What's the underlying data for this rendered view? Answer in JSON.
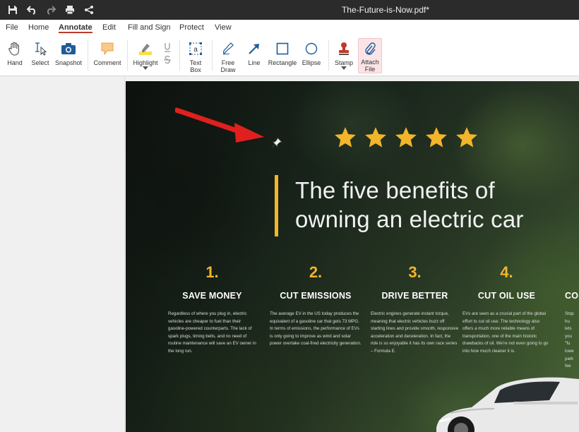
{
  "titlebar": {
    "document_title": "The-Future-is-Now.pdf*",
    "icons": [
      "save-icon",
      "undo-icon",
      "redo-icon",
      "print-icon",
      "share-icon"
    ]
  },
  "menu": {
    "items": [
      "File",
      "Home",
      "Annotate",
      "Edit",
      "Fill and Sign",
      "Protect",
      "View"
    ],
    "active": "Annotate"
  },
  "toolbar": {
    "hand": "Hand",
    "select": "Select",
    "snapshot": "Snapshot",
    "comment": "Comment",
    "highlight": "Highlight",
    "text_box": "Text\nBox",
    "free_draw": "Free\nDraw",
    "line": "Line",
    "rectangle": "Rectangle",
    "ellipse": "Ellipse",
    "stamp": "Stamp",
    "attach_file": "Attach\nFile"
  },
  "document": {
    "rating_stars": 5,
    "headline": "The five benefits of owning an electric car",
    "columns": [
      {
        "number": "1.",
        "title": "SAVE MONEY",
        "body": "Regardless of where you plug in, electric vehicles are cheaper to fuel than their gasoline-powered counterparts. The lack of spark plugs, timing belts, and no need of routine maintenance will save an EV owner in the long run."
      },
      {
        "number": "2.",
        "title": "CUT EMISSIONS",
        "body": "The average EV in the US today produces the equivalent of a gasoline car that gets 73 MPG. In terms of emissions, the performance of EVs is only going to improve as wind and solar power overtake coal-fired electricity generation."
      },
      {
        "number": "3.",
        "title": "DRIVE BETTER",
        "body": "Electric engines generate instant torque, meaning that electric vehicles buzz off starting lines and provide smooth, responsive acceleration and deceleration. In fact, the ride is so enjoyable it has its own race series – Formula E."
      },
      {
        "number": "4.",
        "title": "CUT OIL USE",
        "body": "EVs are seen as a crucial part of the global effort to cut oil use. The technology also offers a much more reliable means of transportation, one of the main historic drawbacks of oil. We're not even going to go into how much cleaner it is."
      },
      {
        "number": "",
        "title": "CO",
        "body": "Stop\nhu\nlets\nyou\n\"fu\nlowe\npark\nfee"
      }
    ]
  },
  "colors": {
    "titlebar_bg": "#2b2b2b",
    "accent_red": "#c0392b",
    "star_yellow": "#f2b52b",
    "arrow_red": "#e0201e"
  }
}
